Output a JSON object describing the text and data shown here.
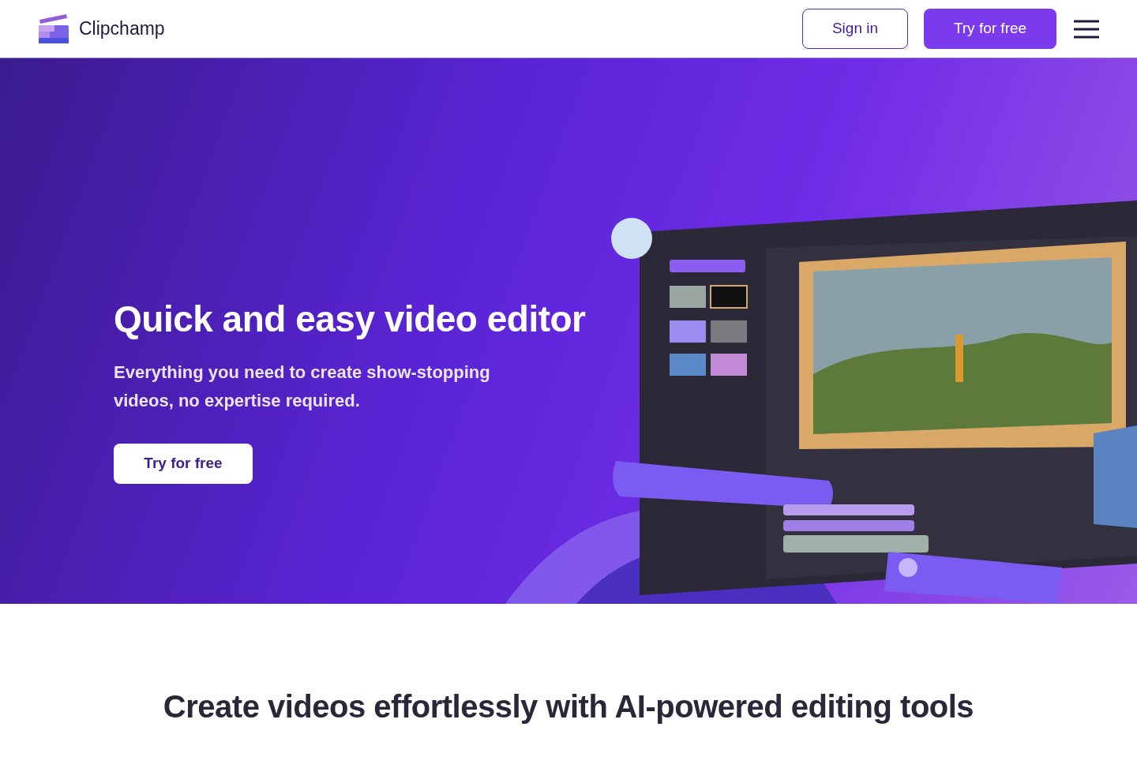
{
  "header": {
    "brand": "Clipchamp",
    "buttons": [
      {
        "kind": "outline",
        "label": "Sign in"
      },
      {
        "kind": "filled",
        "label": "Try for free"
      }
    ]
  },
  "hero": {
    "title": "Quick and easy video editor",
    "subtitle": "Everything you need to create show-stopping videos, no expertise required.",
    "cta": "Try for free"
  },
  "section": {
    "heading": "Create videos effortlessly with AI-powered editing tools"
  }
}
